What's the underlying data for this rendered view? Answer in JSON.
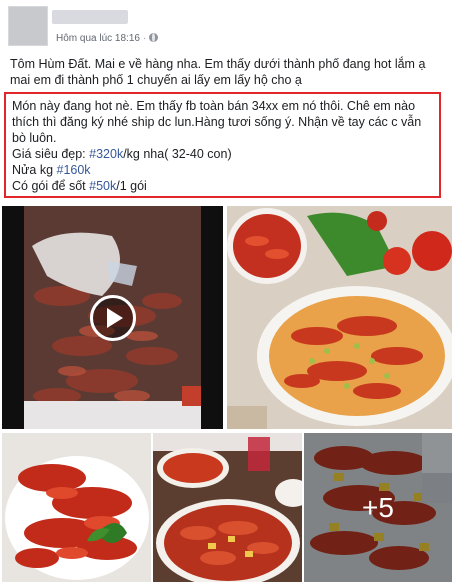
{
  "header": {
    "timestamp": "Hôm qua lúc 18:16",
    "separator": "·"
  },
  "post": {
    "intro": "Tôm Hùm Đất. Mai e về hàng nha. Em thấy dưới thành phố đang hot lắm ạ mai em đi thành phố 1 chuyến ai lấy em lấy hộ cho ạ",
    "highlight": {
      "line1": "Món này đang hot nè. Em thấy fb toàn bán 34xx em nó thôi. Chê em nào thích thì đăng ký nhé ship dc lun.Hàng tươi sống ý. Nhận về tay các c vẫn bò luôn.",
      "price_label": "Giá siêu đẹp: ",
      "price_tag": "#320k",
      "price_suffix": "/kg nha( 32-40 con)",
      "half_label": "Nửa kg ",
      "half_tag": "#160k",
      "sauce_label": "Có gói để sốt ",
      "sauce_tag": "#50k",
      "sauce_suffix": "/1 gói"
    }
  },
  "photos": {
    "more_count": "+5"
  },
  "colors": {
    "highlight_border": "#e0262b",
    "hashtag": "#365899"
  }
}
